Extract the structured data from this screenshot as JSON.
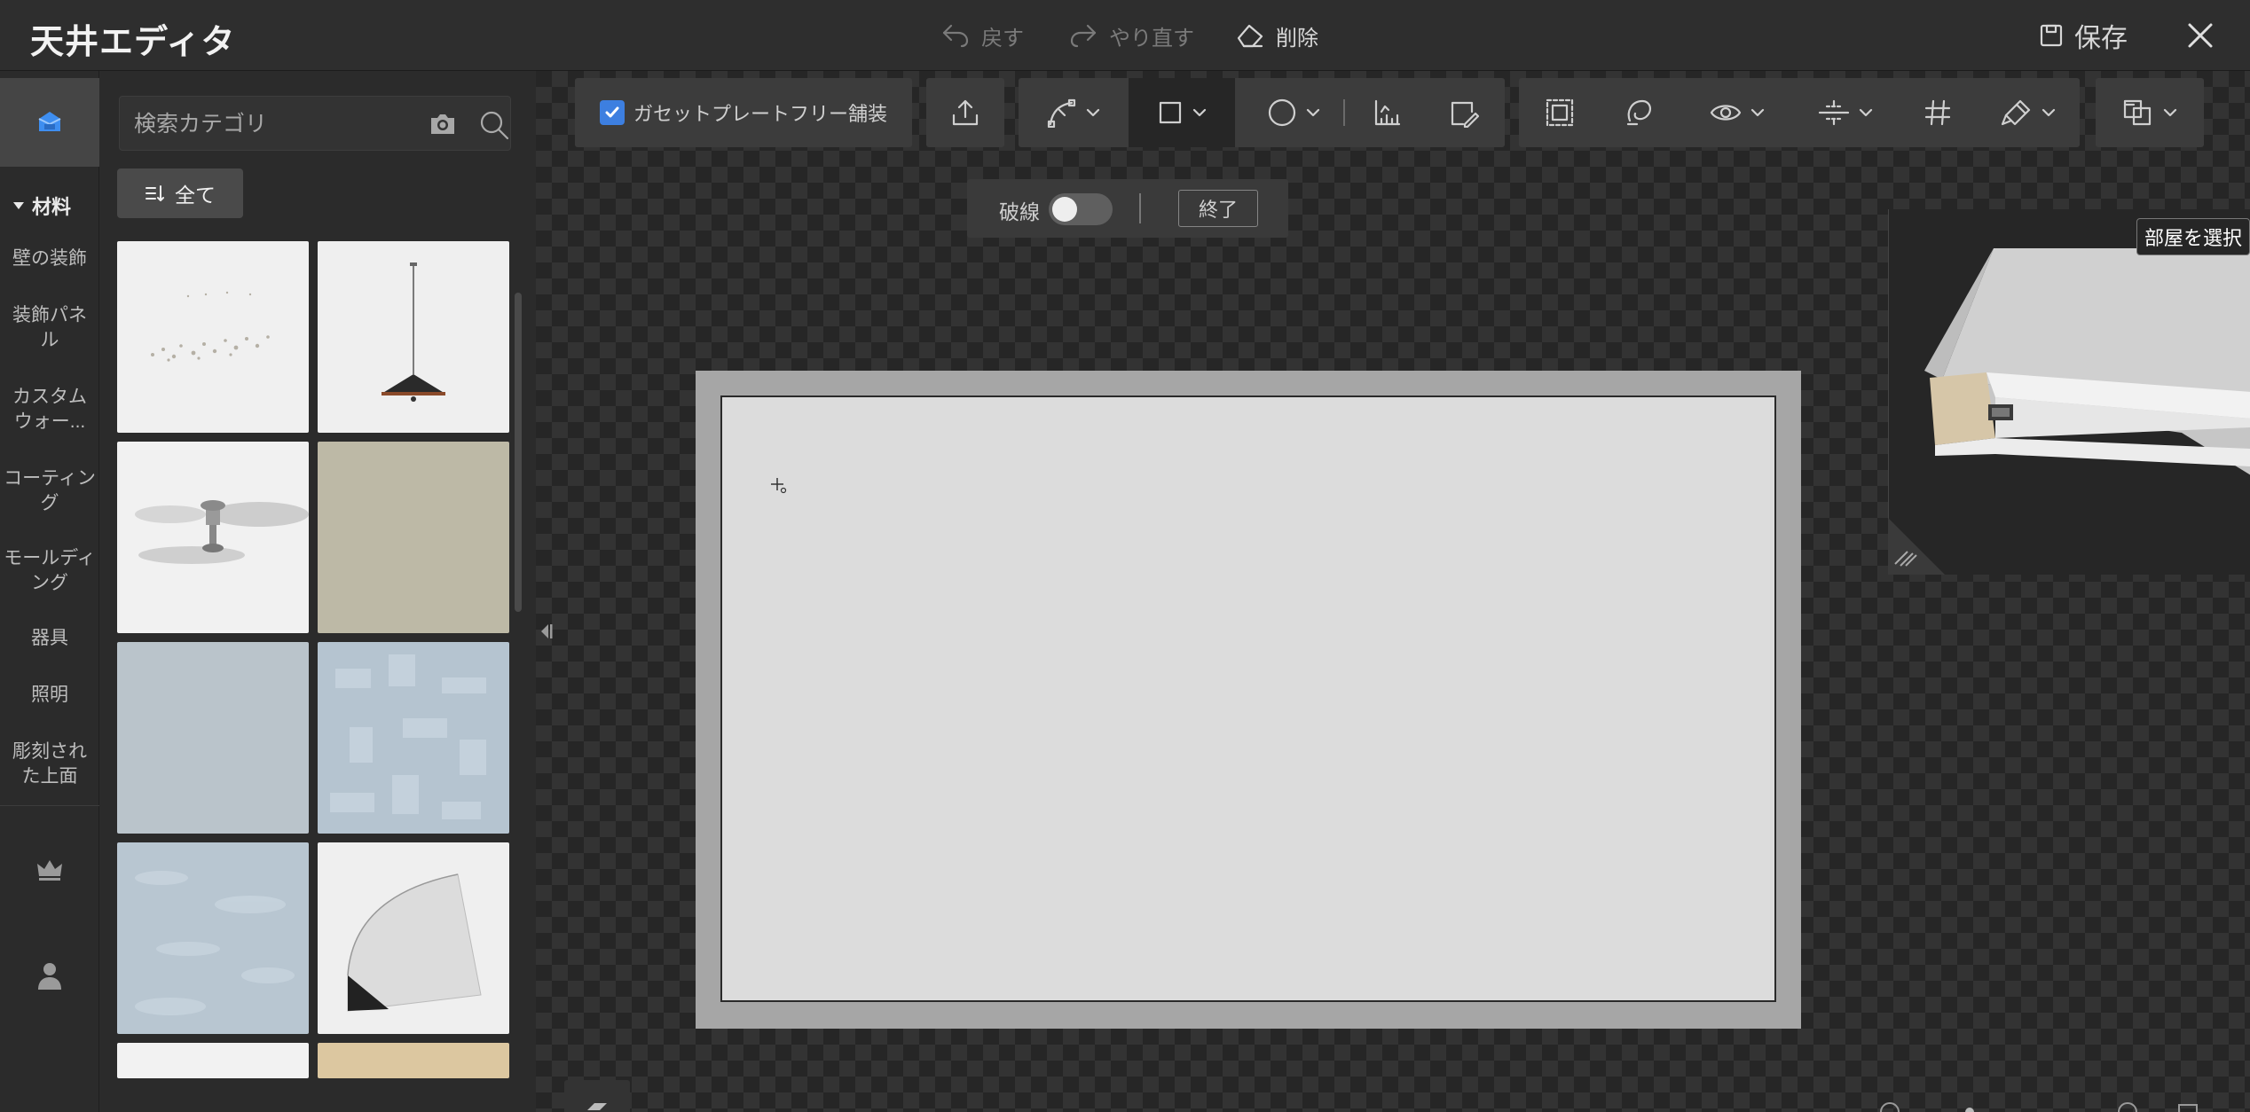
{
  "window": {
    "title": "天井エディタ",
    "undo_label": "戻す",
    "redo_label": "やり直す",
    "delete_label": "削除",
    "save_label": "保存"
  },
  "rail": {
    "section_label": "材料",
    "items": [
      {
        "label": "壁の装飾"
      },
      {
        "label": "装飾パネル"
      },
      {
        "label": "カスタムウォー..."
      },
      {
        "label": "コーティング"
      },
      {
        "label": "モールディング"
      },
      {
        "label": "器具"
      },
      {
        "label": "照明"
      },
      {
        "label": "彫刻された上面"
      }
    ]
  },
  "catalog": {
    "search_placeholder": "検索カテゴリ",
    "filter_label": "全て",
    "thumbnails": [
      {
        "name": "scattered-crystal-light",
        "bg": "#f0f0f0"
      },
      {
        "name": "pendant-lamp",
        "bg": "#efefef"
      },
      {
        "name": "ceiling-fan",
        "bg": "#f1f1f1"
      },
      {
        "name": "beige-texture",
        "bg": "#bdb9a6"
      },
      {
        "name": "blue-gray-plain",
        "bg": "#bac4cb"
      },
      {
        "name": "blue-gray-pattern",
        "bg": "#b5c4d0"
      },
      {
        "name": "blue-marble",
        "bg": "#b8c6d1"
      },
      {
        "name": "cove-molding",
        "bg": "#efefef"
      },
      {
        "name": "white-panel",
        "bg": "#f2f2f2"
      },
      {
        "name": "sand-stone",
        "bg": "#dcc7a0"
      }
    ]
  },
  "toolbar": {
    "gasket_label": "ガセットプレートフリー舗装",
    "gasket_checked": true,
    "icons": [
      "upload-icon",
      "pen-curve-icon",
      "rectangle-icon",
      "circle-icon",
      "ruler-icon",
      "edit-panel-icon",
      "select-area-icon",
      "lasso-icon",
      "eye-icon",
      "align-icon",
      "grid-icon",
      "paint-icon",
      "layers-icon"
    ]
  },
  "break_line": {
    "label": "破線",
    "enabled": false,
    "finish_label": "終了"
  },
  "preview": {
    "select_room_label": "部屋を選択"
  },
  "colors": {
    "accent": "#3d7fe0",
    "titlebar": "#2e2e2e",
    "panel": "#2b2b2b",
    "toolbar": "#3c3c3c",
    "ceiling_frame": "#a6a6a6",
    "ceiling_surface": "#dcdcdc"
  }
}
